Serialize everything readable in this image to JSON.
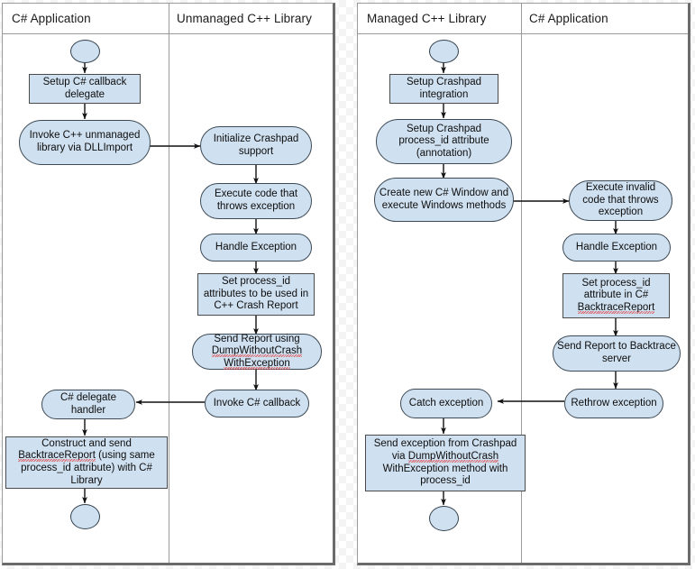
{
  "meta": {
    "kind": "uml-activity-diagram",
    "colors": {
      "node_fill": "#cfe0f0",
      "node_stroke": "#3d4a55",
      "panel_border": "#9a9a9a",
      "arrow": "#111111",
      "spellcheck_underline": "#e04a4a"
    }
  },
  "left_diagram": {
    "name": "unmanaged-cpp-flow",
    "lanes": [
      {
        "id": "lane-csharp-app",
        "title": "C# Application"
      },
      {
        "id": "lane-unmanaged-cpp",
        "title": "Unmanaged C++ Library"
      }
    ],
    "nodes": [
      {
        "id": "l-start",
        "shape": "circle",
        "lane": 0,
        "text": ""
      },
      {
        "id": "l-setup-delegate",
        "shape": "rect",
        "lane": 0,
        "text": "Setup C# callback delegate"
      },
      {
        "id": "l-invoke-cpp",
        "shape": "pill",
        "lane": 0,
        "text": "Invoke C++ unmanaged library via DLLImport"
      },
      {
        "id": "l-init-crashpad",
        "shape": "pill",
        "lane": 1,
        "text": "Initialize Crashpad support"
      },
      {
        "id": "l-throw",
        "shape": "pill",
        "lane": 1,
        "text": "Execute code that throws exception"
      },
      {
        "id": "l-handle-exception",
        "shape": "pill",
        "lane": 1,
        "text": "Handle Exception"
      },
      {
        "id": "l-set-process-id",
        "shape": "rect",
        "lane": 1,
        "text": "Set process_id attributes to be used in C++ Crash Report"
      },
      {
        "id": "l-send-report",
        "shape": "pill",
        "lane": 1,
        "text": "Send Report using DumpWithoutCrash WithException"
      },
      {
        "id": "l-invoke-callback",
        "shape": "pill",
        "lane": 1,
        "text": "Invoke C# callback"
      },
      {
        "id": "l-delegate-handler",
        "shape": "pill",
        "lane": 0,
        "text": "C# delegate handler"
      },
      {
        "id": "l-construct-send",
        "shape": "rect",
        "lane": 0,
        "text": "Construct and send BacktraceReport (using same process_id attribute) with C# Library"
      },
      {
        "id": "l-end",
        "shape": "circle",
        "lane": 0,
        "text": ""
      }
    ]
  },
  "right_diagram": {
    "name": "managed-cpp-flow",
    "lanes": [
      {
        "id": "lane-managed-cpp",
        "title": "Managed C++ Library"
      },
      {
        "id": "lane-csharp-app-2",
        "title": "C# Application"
      }
    ],
    "nodes": [
      {
        "id": "r-start",
        "shape": "circle",
        "lane": 0,
        "text": ""
      },
      {
        "id": "r-setup-crashpad",
        "shape": "rect",
        "lane": 0,
        "text": "Setup Crashpad integration"
      },
      {
        "id": "r-setup-attr",
        "shape": "pill",
        "lane": 0,
        "text": "Setup Crashpad process_id attribute (annotation)"
      },
      {
        "id": "r-create-window",
        "shape": "pill",
        "lane": 0,
        "text": "Create new C# Window and execute Windows methods"
      },
      {
        "id": "r-invalid-code",
        "shape": "pill",
        "lane": 1,
        "text": "Execute invalid code that throws exception"
      },
      {
        "id": "r-handle-exception",
        "shape": "pill",
        "lane": 1,
        "text": "Handle Exception"
      },
      {
        "id": "r-set-process-id",
        "shape": "rect",
        "lane": 1,
        "text": "Set process_id attribute in C# BacktraceReport"
      },
      {
        "id": "r-send-report",
        "shape": "pill",
        "lane": 1,
        "text": "Send Report to Backtrace server"
      },
      {
        "id": "r-rethrow",
        "shape": "pill",
        "lane": 1,
        "text": "Rethrow exception"
      },
      {
        "id": "r-catch",
        "shape": "pill",
        "lane": 0,
        "text": "Catch exception"
      },
      {
        "id": "r-send-from-crashpad",
        "shape": "rect",
        "lane": 0,
        "text": "Send exception from Crashpad via DumpWithoutCrash WithException method with process_id"
      },
      {
        "id": "r-end",
        "shape": "circle",
        "lane": 0,
        "text": ""
      }
    ]
  }
}
